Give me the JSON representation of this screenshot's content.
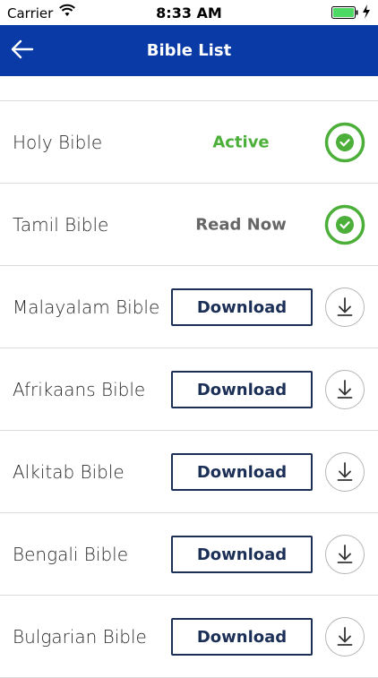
{
  "status_bar": {
    "carrier": "Carrier",
    "time": "8:33 AM"
  },
  "header": {
    "title": "Bible List",
    "back_icon": "arrow-left-icon"
  },
  "colors": {
    "nav_bg": "#0a3aa6",
    "active_green": "#4caf3a",
    "read_gray": "#666666",
    "button_navy": "#1c2f57"
  },
  "bibles": [
    {
      "name": "Holy Bible",
      "state": "active",
      "status": "Active",
      "icon": "check-circle-icon"
    },
    {
      "name": "Tamil Bible",
      "state": "read",
      "status": "Read Now",
      "icon": "check-circle-icon"
    },
    {
      "name": "Malayalam Bible",
      "state": "download",
      "status": "Download",
      "icon": "download-icon"
    },
    {
      "name": "Afrikaans Bible",
      "state": "download",
      "status": "Download",
      "icon": "download-icon"
    },
    {
      "name": "Alkitab Bible",
      "state": "download",
      "status": "Download",
      "icon": "download-icon"
    },
    {
      "name": "Bengali Bible",
      "state": "download",
      "status": "Download",
      "icon": "download-icon"
    },
    {
      "name": "Bulgarian Bible",
      "state": "download",
      "status": "Download",
      "icon": "download-icon"
    }
  ]
}
